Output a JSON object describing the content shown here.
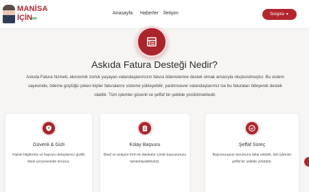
{
  "brand": {
    "line1": "MANİSA",
    "line2": "İÇİN",
    "arrows": "»»"
  },
  "nav": {
    "items": [
      "Anasayfa",
      "Haberler",
      "İletişim"
    ],
    "cta": "Sorgula"
  },
  "hero": {
    "title": "Askıda Fatura Desteği Nedir?",
    "description": "Askıda Fatura hizmeti, ekonomik zorluk yaşayan vatandaşlarımızın fatura ödemelerine destek olmak amacıyla oluşturulmuştur. Bu sistem sayesinde, ödeme güçlüğü çeken kişiler faturalarını sisteme yükleyebilir, yardımsever vatandaşlarımız ise bu faturaları ödeyerek destek olabilir. Tüm işlemler güvenli ve şeffaf bir şekilde yürütülmektedir."
  },
  "cards": [
    {
      "title": "Güvenli & Gizli",
      "text": "Kişisel bilgileriniz ve başvuru detaylarınız gizlilik ilkesi çerçevesinde korunur.",
      "icon": "shield-icon"
    },
    {
      "title": "Kolay Başvuru",
      "text": "Basit ve anlaşılır form ile dakikalar içinde başvurunuzu tamamlayabilirsiniz.",
      "icon": "clipboard-icon"
    },
    {
      "title": "Şeffaf Süreç",
      "text": "Başvurunuzun durumunu takip edebilir, tüm işlemler şeffaf bir şekilde yürütülür.",
      "icon": "check-circle-icon"
    }
  ],
  "colors": {
    "accent": "#b3262e",
    "background": "#f6f5f4",
    "logo_arrows": "#2e9e57"
  }
}
